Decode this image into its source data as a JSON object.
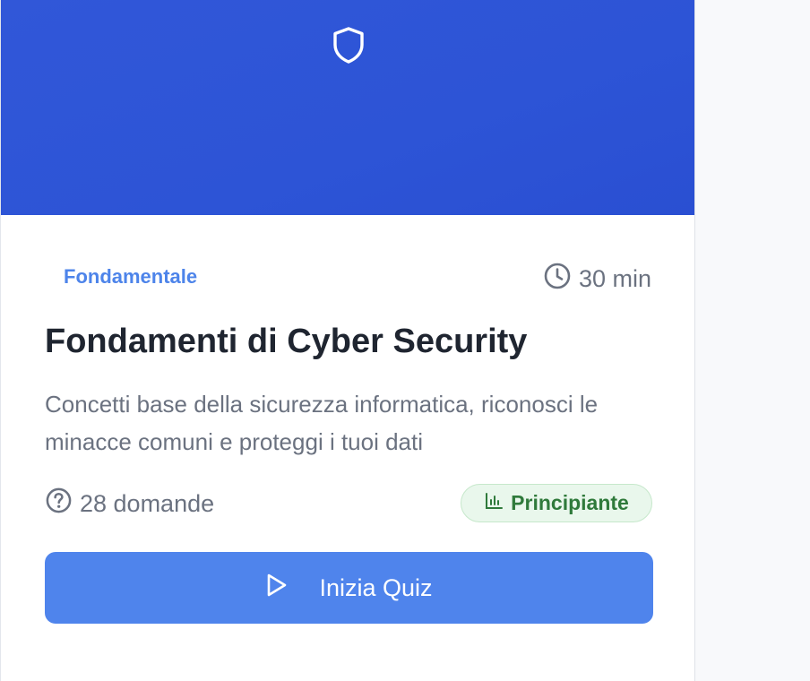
{
  "card": {
    "category": "Fondamentale",
    "duration": "30 min",
    "title": "Fondamenti di Cyber Security",
    "description": "Concetti base della sicurezza informatica, riconosci le minacce comuni e proteggi i tuoi dati",
    "questions": "28 domande",
    "level": "Principiante",
    "start_label": "Inizia Quiz"
  },
  "icons": {
    "hero": "shield-icon",
    "duration": "clock-icon",
    "questions": "question-circle-icon",
    "level": "bar-chart-icon",
    "start": "play-icon"
  },
  "colors": {
    "hero": "#2d54d6",
    "accent": "#4f84ec",
    "badge_bg": "#e9f7ec",
    "badge_text": "#2f7a3b"
  }
}
